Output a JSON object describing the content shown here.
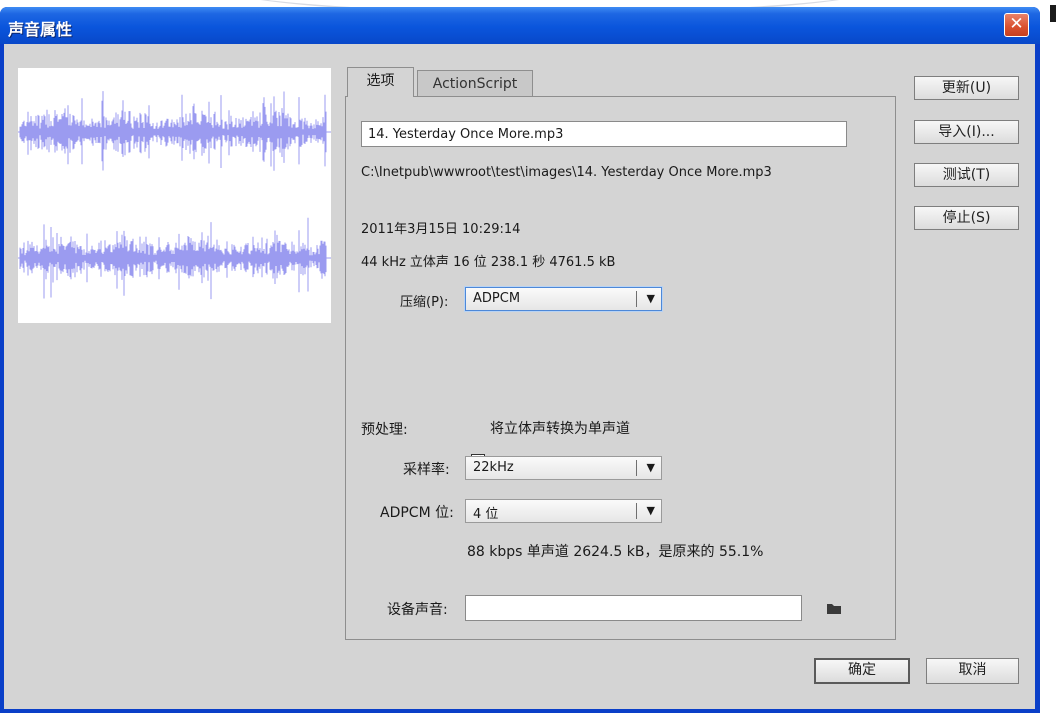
{
  "window": {
    "title": "声音属性",
    "close_glyph": "✕"
  },
  "tabs": {
    "options_label": "选项",
    "actionscript_label": "ActionScript"
  },
  "sound": {
    "name_value": "14. Yesterday Once More.mp3",
    "path": "C:\\Inetpub\\wwwroot\\test\\images\\14. Yesterday Once More.mp3",
    "date": "2011年3月15日  10:29:14",
    "info": "44 kHz 立体声 16 位 238.1 秒 4761.5 kB"
  },
  "compression": {
    "label": "压缩(P):",
    "value": "ADPCM"
  },
  "preprocess": {
    "label": "预处理:",
    "checkbox_label": "将立体声转换为单声道",
    "checked": true
  },
  "sample_rate": {
    "label": "采样率:",
    "value": "22kHz"
  },
  "adpcm_bits": {
    "label": "ADPCM 位:",
    "value": "4 位"
  },
  "result_text": "88 kbps  单声道 2624.5 kB，是原来的 55.1%",
  "device_sound": {
    "label": "设备声音:",
    "value": ""
  },
  "buttons": {
    "update": "更新(U)",
    "import": "导入(I)...",
    "test": "测试(T)",
    "stop": "停止(S)",
    "ok": "确定",
    "cancel": "取消"
  },
  "colors": {
    "titlebar": "#0a55dc",
    "dialog_bg": "#d4d4d4",
    "waveform": "#9b9bf0",
    "close_button": "#d9502f"
  },
  "icons": {
    "checkbox": "check-mark",
    "dropdown": "down-triangle",
    "folder": "folder-icon",
    "close": "close-x"
  },
  "waveform": {
    "channels": 2
  }
}
